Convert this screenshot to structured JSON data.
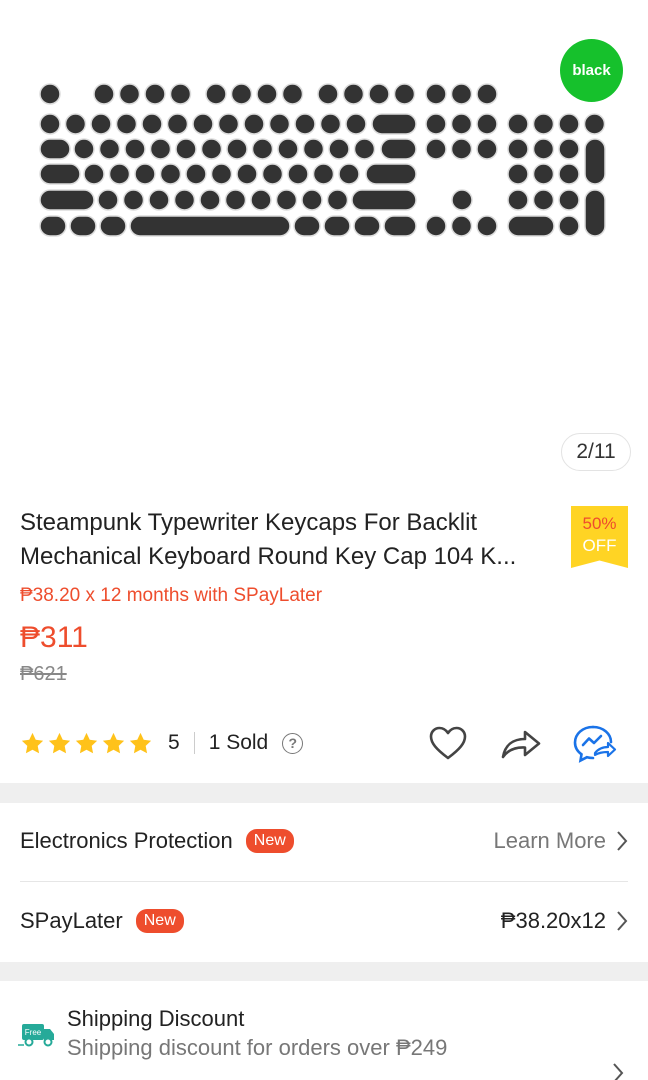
{
  "image": {
    "color_badge": "black",
    "counter": "2/11"
  },
  "product": {
    "title_line1": "Steampunk Typewriter Keycaps For Backlit",
    "title_line2": "Mechanical Keyboard Round Key Cap 104 K...",
    "discount_pct": "50%",
    "discount_off": "OFF",
    "installment": "₱38.20 x 12 months with SPayLater",
    "price": "₱311",
    "old_price": "₱621"
  },
  "rating": {
    "stars": 5,
    "value": "5",
    "sold": "1 Sold",
    "help_icon": "?"
  },
  "actions": {
    "icons": [
      "heart-icon",
      "share-icon",
      "chat-icon"
    ]
  },
  "electronics_protection": {
    "label": "Electronics Protection",
    "badge": "New",
    "link": "Learn More"
  },
  "spaylater": {
    "label": "SPayLater",
    "badge": "New",
    "value": "₱38.20x12"
  },
  "shipping": {
    "icon_text": "Free",
    "title": "Shipping Discount",
    "subtitle": "Shipping discount for orders over ₱249"
  },
  "colors": {
    "accent": "#ee4d2d",
    "star": "#ffc21a",
    "badge_green": "#16c12c",
    "chat_blue": "#1a73e8"
  }
}
